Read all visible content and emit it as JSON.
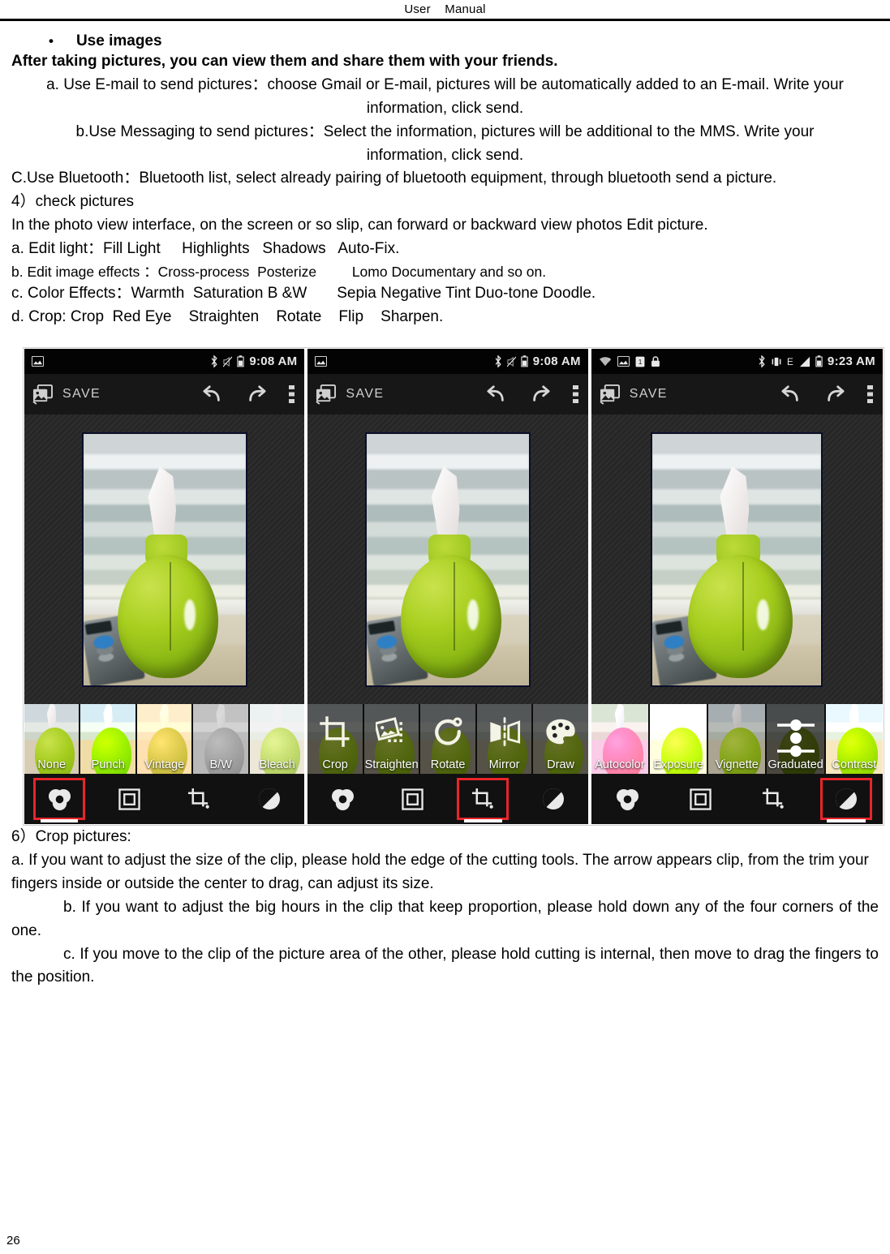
{
  "header": {
    "title": "User    Manual"
  },
  "body": {
    "bullet_title": "Use images",
    "intro": "After taking pictures, you can view them and share them with your friends.",
    "item_a": "a. Use E-mail to send pictures：choose Gmail or E-mail, pictures will be automatically added to an E-mail. Write your information, click send.",
    "item_b": "b.Use Messaging to send pictures：Select the information, pictures will be additional to the MMS. Write your information, click send.",
    "item_c": "C.Use Bluetooth：Bluetooth list, select already pairing of bluetooth equipment, through bluetooth send a picture.",
    "item_4": "4）check pictures",
    "photo_view_line": "In the photo view interface, on the screen or so slip, can forward or backward view photos Edit picture.",
    "sub_a": "a. Edit light：Fill Light     Highlights   Shadows   Auto-Fix.",
    "sub_b": "b. Edit image effects ：Cross-process  Posterize         Lomo Documentary and so on.",
    "sub_c": "c. Color Effects：Warmth  Saturation B &W       Sepia Negative Tint Duo-tone Doodle.",
    "sub_d": "d. Crop: Crop  Red Eye    Straighten    Rotate    Flip    Sharpen.",
    "item_6": "6）Crop pictures:",
    "item_6a": "a. If you want to adjust the size of the clip, please hold the edge of the cutting tools. The arrow appears clip, from the trim your fingers inside or outside the center to drag, can adjust its size.",
    "item_6b": "b. If you want to adjust the big hours in the clip that keep proportion, please hold down any of the four corners of the one.",
    "item_6c": "c. If you move to the clip of the picture area of the other, please hold cutting is internal, then move to drag the fingers to the position.",
    "page_number": "26"
  },
  "screenshots": [
    {
      "id": "effects-screen",
      "statusbar": {
        "left_icons": [
          "photo-notification-icon"
        ],
        "right_icons": [
          "bluetooth-icon",
          "silent-icon",
          "battery-icon"
        ],
        "clock": "9:08 AM"
      },
      "actionbar": {
        "save_label": "SAVE",
        "icons": [
          "photos-icon",
          "undo-icon",
          "redo-icon",
          "overflow-menu-icon"
        ]
      },
      "thumbnails": [
        {
          "label": "None",
          "variant": "v-none",
          "selected": true
        },
        {
          "label": "Punch",
          "variant": "v-punch",
          "selected": false
        },
        {
          "label": "Vintage",
          "variant": "v-vintage",
          "selected": false
        },
        {
          "label": "B/W",
          "variant": "v-bw",
          "selected": false
        },
        {
          "label": "Bleach",
          "variant": "v-bleach",
          "selected": false
        }
      ],
      "tabs": [
        {
          "icon": "filters-icon",
          "highlighted": true
        },
        {
          "icon": "frames-icon",
          "highlighted": false
        },
        {
          "icon": "crop-icon",
          "highlighted": false
        },
        {
          "icon": "exposure-icon",
          "highlighted": false
        }
      ]
    },
    {
      "id": "crop-tools-screen",
      "statusbar": {
        "left_icons": [
          "photo-notification-icon"
        ],
        "right_icons": [
          "bluetooth-icon",
          "silent-icon",
          "battery-icon"
        ],
        "clock": "9:08 AM"
      },
      "actionbar": {
        "save_label": "SAVE",
        "icons": [
          "photos-icon",
          "undo-icon",
          "redo-icon",
          "overflow-menu-icon"
        ]
      },
      "thumbnails": [
        {
          "label": "Crop",
          "icon": "crop-tool-icon",
          "selected": false
        },
        {
          "label": "Straighten",
          "icon": "straighten-tool-icon",
          "selected": false
        },
        {
          "label": "Rotate",
          "icon": "rotate-tool-icon",
          "selected": false
        },
        {
          "label": "Mirror",
          "icon": "mirror-tool-icon",
          "selected": false
        },
        {
          "label": "Draw",
          "icon": "draw-tool-icon",
          "selected": false
        }
      ],
      "tabs": [
        {
          "icon": "filters-icon",
          "highlighted": false
        },
        {
          "icon": "frames-icon",
          "highlighted": false
        },
        {
          "icon": "crop-icon",
          "highlighted": true
        },
        {
          "icon": "exposure-icon",
          "highlighted": false
        }
      ]
    },
    {
      "id": "adjust-screen",
      "statusbar": {
        "left_icons": [
          "wifi-question-icon",
          "screenshot-icon",
          "sim-icon",
          "lock-icon"
        ],
        "right_icons": [
          "bluetooth-icon",
          "vibrate-icon",
          "edge-network-icon",
          "signal-icon",
          "battery-icon"
        ],
        "clock": "9:23 AM"
      },
      "actionbar": {
        "save_label": "SAVE",
        "icons": [
          "photos-icon",
          "undo-icon",
          "redo-icon",
          "overflow-menu-icon"
        ]
      },
      "thumbnails": [
        {
          "label": "Autocolor",
          "variant": "v-autocolor",
          "selected": false
        },
        {
          "label": "Exposure",
          "variant": "v-exposure",
          "selected": false
        },
        {
          "label": "Vignette",
          "variant": "v-vignette",
          "selected": false
        },
        {
          "label": "Graduated",
          "variant": "v-grad",
          "selected": false
        },
        {
          "label": "Contrast",
          "variant": "v-contrast",
          "selected": false
        }
      ],
      "tabs": [
        {
          "icon": "filters-icon",
          "highlighted": false
        },
        {
          "icon": "frames-icon",
          "highlighted": false
        },
        {
          "icon": "crop-icon",
          "highlighted": false
        },
        {
          "icon": "exposure-icon",
          "highlighted": true
        }
      ]
    }
  ],
  "colors": {
    "highlight": "#e8252a",
    "statusbar_bg": "#030303",
    "actionbar_bg": "#171717",
    "tabbar_bg": "#111111"
  }
}
